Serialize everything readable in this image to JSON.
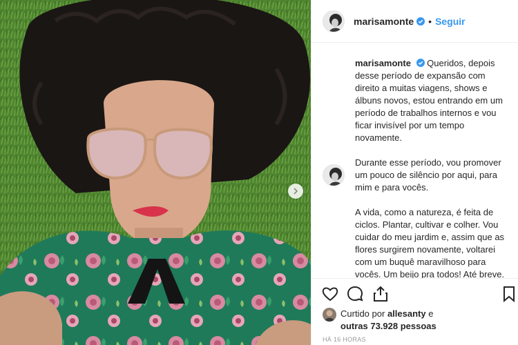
{
  "post": {
    "username": "marisamonte",
    "follow_label": "Seguir",
    "separator": "•",
    "caption_paragraphs": [
      "Queridos, depois desse período de expansão com direito a muitas viagens, shows e álbuns novos, estou entrando em um período de trabalhos internos e vou ficar invisível por um tempo novamente.",
      "Durante esse período, vou promover um pouco de silêncio por aqui, para mim e para vocês.",
      "A vida, como a natureza, é feita de ciclos. Plantar, cultivar e colher. Vou cuidar do meu jardim e, assim que as flores surgirem novamente, voltarei com um buquê maravilhoso para vocês. Um beijo pra todos! Até breve."
    ],
    "caption_emoji": "leaf-icon",
    "likes_prefix": "Curtido por",
    "likes_user": "allesanty",
    "likes_connector": "e",
    "likes_others": "outras 73.928 pessoas",
    "timestamp": "HÁ 16 HORAS"
  },
  "colors": {
    "accent": "#3897f0",
    "text": "#262626",
    "muted": "#999999",
    "border": "#efefef",
    "grass": "#4a7d2a",
    "dress": "#1f7a5a"
  },
  "icons": [
    "verified-icon",
    "heart-icon",
    "comment-icon",
    "share-icon",
    "bookmark-icon",
    "chevron-right-icon"
  ]
}
